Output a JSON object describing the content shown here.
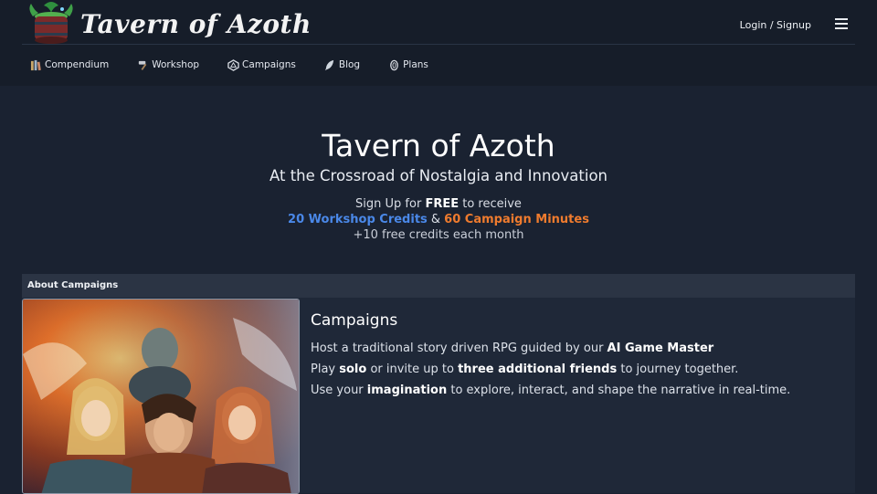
{
  "header": {
    "logo_text": "Tavern of Azoth",
    "login_label": "Login / Signup"
  },
  "nav": [
    {
      "label": "Compendium",
      "icon": "books-icon"
    },
    {
      "label": "Workshop",
      "icon": "hammer-icon"
    },
    {
      "label": "Campaigns",
      "icon": "dice-icon"
    },
    {
      "label": "Blog",
      "icon": "quill-icon"
    },
    {
      "label": "Plans",
      "icon": "coins-icon"
    }
  ],
  "hero": {
    "title": "Tavern of Azoth",
    "subtitle": "At the Crossroad of Nostalgia and Innovation",
    "promo_pre": "Sign Up for ",
    "promo_free": "FREE",
    "promo_post": " to receive",
    "workshop_credits": "20 Workshop Credits",
    "amp": " & ",
    "campaign_minutes": "60 Campaign Minutes",
    "monthly": "+10 free credits each month"
  },
  "about": {
    "header": "About Campaigns",
    "title": "Campaigns",
    "line1_pre": "Host a traditional story driven RPG guided by our ",
    "line1_bold": "AI Game Master",
    "line2_a": "Play ",
    "line2_b": "solo",
    "line2_c": " or invite up to ",
    "line2_d": "three additional friends",
    "line2_e": " to journey together.",
    "line3_a": "Use your ",
    "line3_b": "imagination",
    "line3_c": " to explore, interact, and shape the narrative in real-time."
  },
  "colors": {
    "background": "#1a2231",
    "workshop_credits": "#4a88e8",
    "campaign_minutes": "#ef7b2e"
  }
}
